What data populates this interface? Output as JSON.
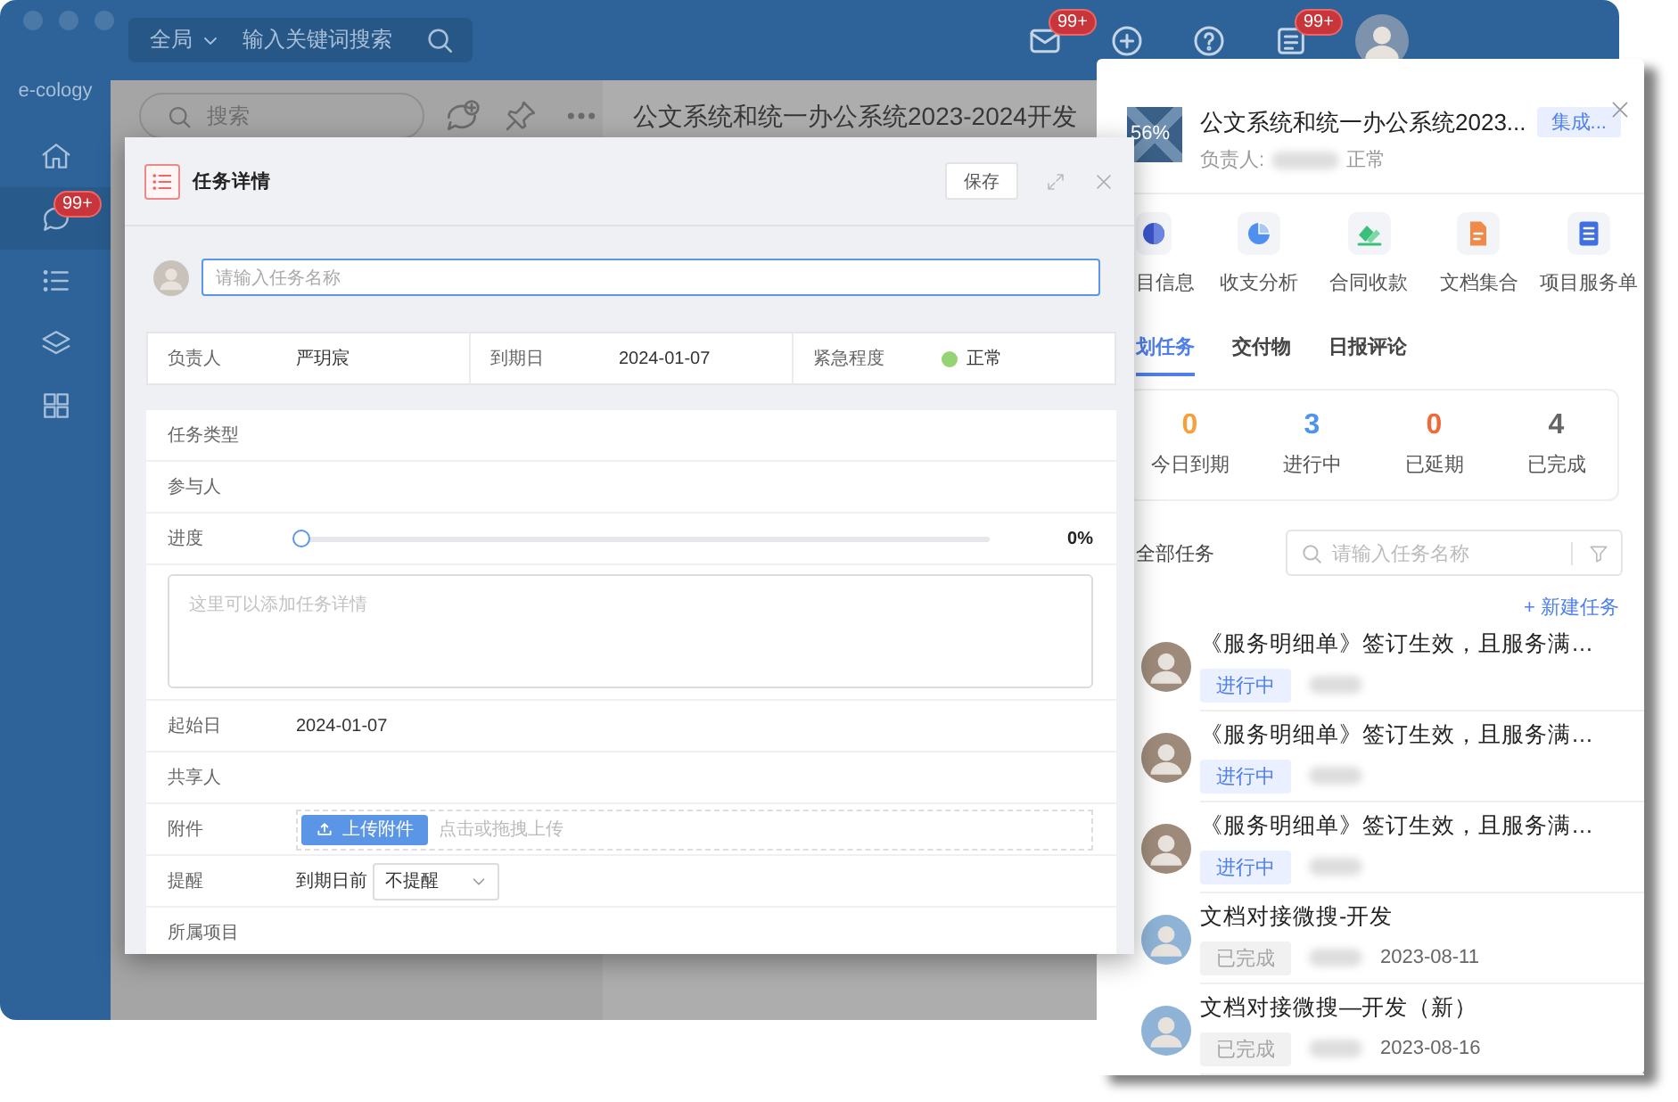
{
  "app": {
    "logo": "e-cology",
    "search": {
      "scope": "全局",
      "placeholder": "输入关键词搜索"
    },
    "mail_badge": "99+",
    "notice_badge": "99+",
    "nav": [
      {
        "selected": false
      },
      {
        "selected": true,
        "badge": "99+"
      },
      {
        "selected": false
      },
      {
        "selected": false
      },
      {
        "selected": false
      }
    ],
    "list_search": {
      "placeholder": "搜索"
    },
    "page_title": "公文系统和统一办公系统2023-2024开发"
  },
  "task_dialog": {
    "title": "任务详情",
    "save": "保存",
    "name_placeholder": "请输入任务名称",
    "summary": [
      {
        "label": "负责人",
        "value": "严玥宸"
      },
      {
        "label": "到期日",
        "value": "2024-01-07"
      },
      {
        "label": "紧急程度",
        "value": "正常",
        "color": "#95d475"
      }
    ],
    "fields": [
      {
        "kind": "text",
        "label": "任务类型"
      },
      {
        "kind": "text",
        "label": "参与人"
      },
      {
        "kind": "slider",
        "label": "进度",
        "level": 0,
        "reading": "0%"
      },
      {
        "kind": "textarea",
        "placeholder": "这里可以添加任务详情"
      },
      {
        "kind": "text",
        "label": "起始日",
        "value": "2024-01-07"
      },
      {
        "kind": "text",
        "label": "共享人"
      },
      {
        "kind": "upload",
        "label": "附件",
        "button": "上传附件",
        "hint": "点击或拖拽上传"
      },
      {
        "kind": "reminder",
        "label": "提醒",
        "prefix": "到期日前",
        "value": "不提醒"
      },
      {
        "kind": "text",
        "label": "所属项目"
      }
    ]
  },
  "project_panel": {
    "progress": "56%",
    "title": "公文系统和统一办公系统2023...",
    "tag": "集成...",
    "owner_label": "负责人:",
    "status": "正常",
    "shortcuts": [
      "目信息",
      "收支分析",
      "合同收款",
      "文档集合",
      "项目服务单"
    ],
    "tabs": [
      {
        "label": "划任务",
        "selected": true
      },
      {
        "label": "交付物",
        "selected": false
      },
      {
        "label": "日报评论",
        "selected": false
      }
    ],
    "stats": [
      {
        "value": "0",
        "label": "今日到期",
        "color": "#f5a03c"
      },
      {
        "value": "3",
        "label": "进行中",
        "color": "#4e95ea"
      },
      {
        "value": "0",
        "label": "已延期",
        "color": "#ee6a3a"
      },
      {
        "value": "4",
        "label": "已完成",
        "color": "#666666"
      }
    ],
    "list_title": "全部任务",
    "search_placeholder": "请输入任务名称",
    "new_task": "+ 新建任务",
    "tasks": [
      {
        "title": "《服务明细单》签订生效，且服务满…",
        "status": "进行中",
        "kind": "ongoing"
      },
      {
        "title": "《服务明细单》签订生效，且服务满…",
        "status": "进行中",
        "kind": "ongoing"
      },
      {
        "title": "《服务明细单》签订生效，且服务满…",
        "status": "进行中",
        "kind": "ongoing"
      },
      {
        "title": "文档对接微搜-开发",
        "status": "已完成",
        "kind": "done",
        "date": "2023-08-11"
      },
      {
        "title": "文档对接微搜—开发（新）",
        "status": "已完成",
        "kind": "done",
        "date": "2023-08-16"
      }
    ]
  }
}
